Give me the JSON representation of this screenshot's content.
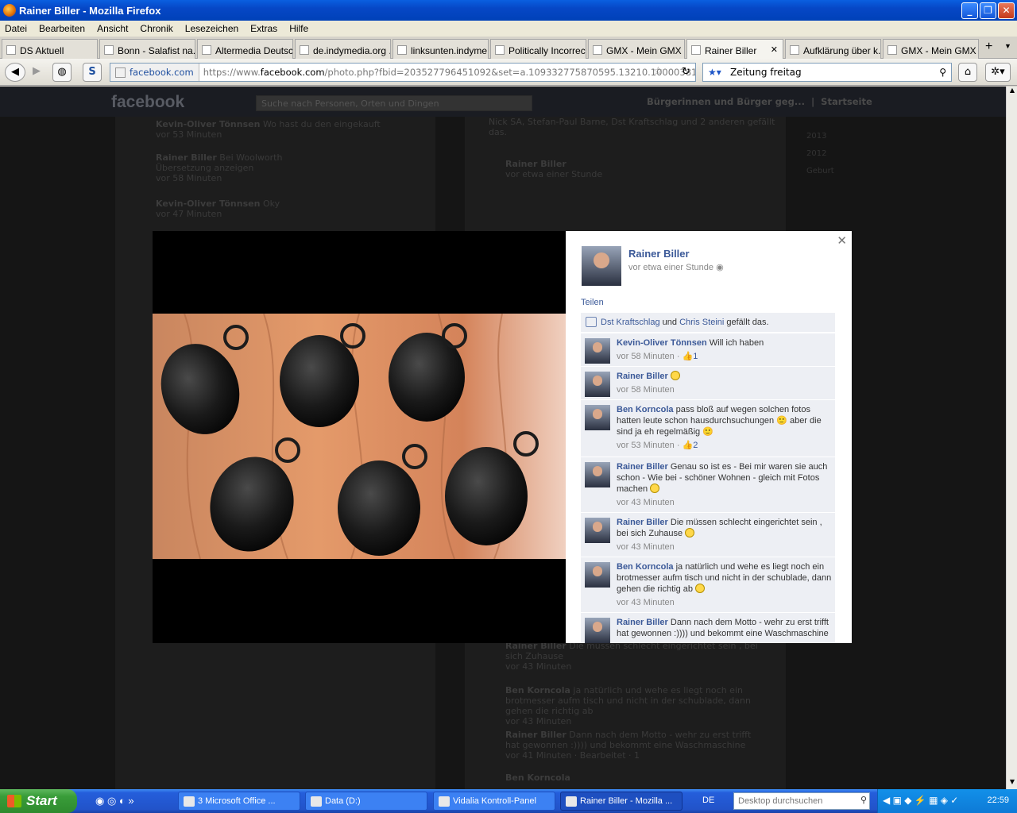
{
  "window": {
    "title": "Rainer Biller - Mozilla Firefox"
  },
  "menu": [
    "Datei",
    "Bearbeiten",
    "Ansicht",
    "Chronik",
    "Lesezeichen",
    "Extras",
    "Hilfe"
  ],
  "tabs": [
    {
      "label": "DS Aktuell"
    },
    {
      "label": "Bonn - Salafist na..."
    },
    {
      "label": "Altermedia Deutsc..."
    },
    {
      "label": "de.indymedia.org ..."
    },
    {
      "label": "linksunten.indyme..."
    },
    {
      "label": "Politically Incorrect"
    },
    {
      "label": "GMX - Mein GMX"
    },
    {
      "label": "Rainer Biller",
      "active": true
    },
    {
      "label": "Aufklärung über k..."
    },
    {
      "label": "GMX - Mein GMX"
    }
  ],
  "nav": {
    "site_badge": "facebook.com",
    "url_prefix": "https://www.",
    "url_domain": "facebook.com",
    "url_rest": "/photo.php?fbid=203527796451092&set=a.109332775870595.13210.100003816202362&t",
    "search_value": "Zeitung freitag"
  },
  "facebook": {
    "logo": "facebook",
    "search_placeholder": "Suche nach Personen, Orten und Dingen",
    "page_link": "Bürgerinnen und Bürger geg...",
    "home_link": "Startseite"
  },
  "background": {
    "left_items": [
      {
        "name": "Kevin-Oliver Tönnsen",
        "text": "Wo hast du den eingekauft",
        "time": "vor 53 Minuten"
      },
      {
        "name": "Rainer Biller",
        "text": "Bei Woolworth",
        "sub": "Übersetzung anzeigen",
        "time": "vor 58 Minuten"
      },
      {
        "name": "Kevin-Oliver Tönnsen",
        "text": "Oky",
        "time": "vor 47 Minuten"
      }
    ],
    "right_items": [
      {
        "text": "Nick SA, Stefan-Paul Barne, Dst Kraftschlag und 2 anderen gefällt das."
      },
      {
        "name": "Rainer Biller",
        "time": "vor etwa einer Stunde"
      },
      {
        "name": "Rainer Biller",
        "text": "Die müssen schlecht eingerichtet sein , bei sich Zuhause",
        "time": "vor 43 Minuten"
      },
      {
        "name": "Ben Korncola",
        "text": "ja natürlich und wehe es liegt noch ein brotmesser aufm tisch und nicht in der schublade, dann gehen die richtig ab",
        "time": "vor 43 Minuten"
      },
      {
        "name": "Rainer Biller",
        "text": "Dann nach dem Motto - wehr zu erst trifft hat gewonnen :)))) und bekommt eine Waschmaschine",
        "time": "vor 41 Minuten · Bearbeitet · 1"
      },
      {
        "name": "Ben Korncola"
      }
    ],
    "sidebar_links": [
      "2013",
      "2012",
      "Geburt"
    ]
  },
  "panel": {
    "author": "Rainer Biller",
    "time": "vor etwa einer Stunde",
    "share": "Teilen",
    "likes": {
      "a": "Dst Kraftschlag",
      "and": "und",
      "b": "Chris Steini",
      "suffix": "gefällt das."
    },
    "comments": [
      {
        "name": "Kevin-Oliver Tönnsen",
        "text": "Will ich haben",
        "time": "vor 58 Minuten",
        "likes": "1"
      },
      {
        "name": "Rainer Biller",
        "text": "",
        "smile": true,
        "time": "vor 58 Minuten"
      },
      {
        "name": "Ben Korncola",
        "text": "pass bloß auf wegen solchen fotos hatten leute schon hausdurchsuchungen 🙂 aber die sind ja eh regelmäßig 🙂",
        "time": "vor 53 Minuten",
        "likes": "2"
      },
      {
        "name": "Rainer Biller",
        "text": "Genau so ist es - Bei mir waren sie auch schon - Wie bei - schöner Wohnen - gleich mit Fotos machen",
        "smile": true,
        "time": "vor 43 Minuten"
      },
      {
        "name": "Rainer Biller",
        "text": "Die müssen schlecht eingerichtet sein , bei sich Zuhause",
        "smile": true,
        "time": "vor 43 Minuten"
      },
      {
        "name": "Ben Korncola",
        "text": "ja natürlich und wehe es liegt noch ein brotmesser aufm tisch und nicht in der schublade, dann gehen die richtig ab",
        "smile": true,
        "time": "vor 43 Minuten"
      },
      {
        "name": "Rainer Biller",
        "text": "Dann nach dem Motto - wehr zu erst trifft hat gewonnen :)))) und bekommt eine Waschmaschine"
      }
    ]
  },
  "taskbar": {
    "start": "Start",
    "tasks": [
      "3 Microsoft Office ...",
      "Data (D:)",
      "Vidalia Kontroll-Panel",
      "Rainer Biller - Mozilla ..."
    ],
    "lang": "DE",
    "search_placeholder": "Desktop durchsuchen",
    "clock": "22:59"
  }
}
